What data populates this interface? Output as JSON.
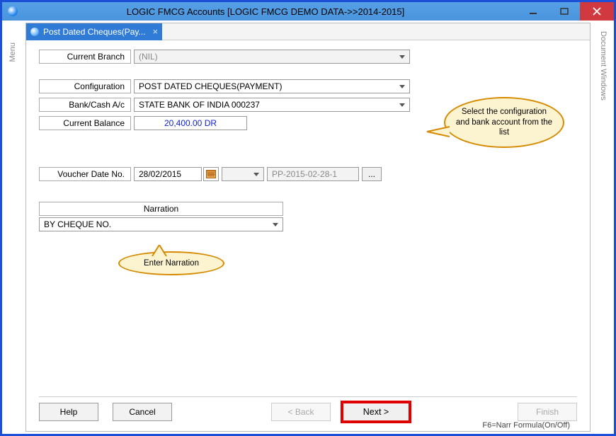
{
  "window": {
    "title": "LOGIC FMCG Accounts  [LOGIC FMCG DEMO DATA->>2014-2015]"
  },
  "side_labels": {
    "left": "Menu",
    "right": "Document Windows"
  },
  "tab": {
    "label": "Post Dated Cheques(Pay..."
  },
  "form": {
    "branch_label": "Current Branch",
    "branch_value": "(NIL)",
    "config_label": "Configuration",
    "config_value": "POST DATED CHEQUES(PAYMENT)",
    "bank_label": "Bank/Cash A/c",
    "bank_value": "STATE BANK OF INDIA 000237",
    "balance_label": "Current Balance",
    "balance_value": "20,400.00 DR",
    "voucher_label": "Voucher Date  No.",
    "voucher_date": "28/02/2015",
    "voucher_no": "PP-2015-02-28-1",
    "narration_header": "Narration",
    "narration_value": "BY CHEQUE NO."
  },
  "callouts": {
    "c1": "Select the configuration and bank account from the list",
    "c2": "Enter Narration"
  },
  "buttons": {
    "help": "Help",
    "cancel": "Cancel",
    "back": "< Back",
    "next": "Next >",
    "finish": "Finish"
  },
  "footnote": "F6=Narr Formula(On/Off)",
  "dots": "..."
}
